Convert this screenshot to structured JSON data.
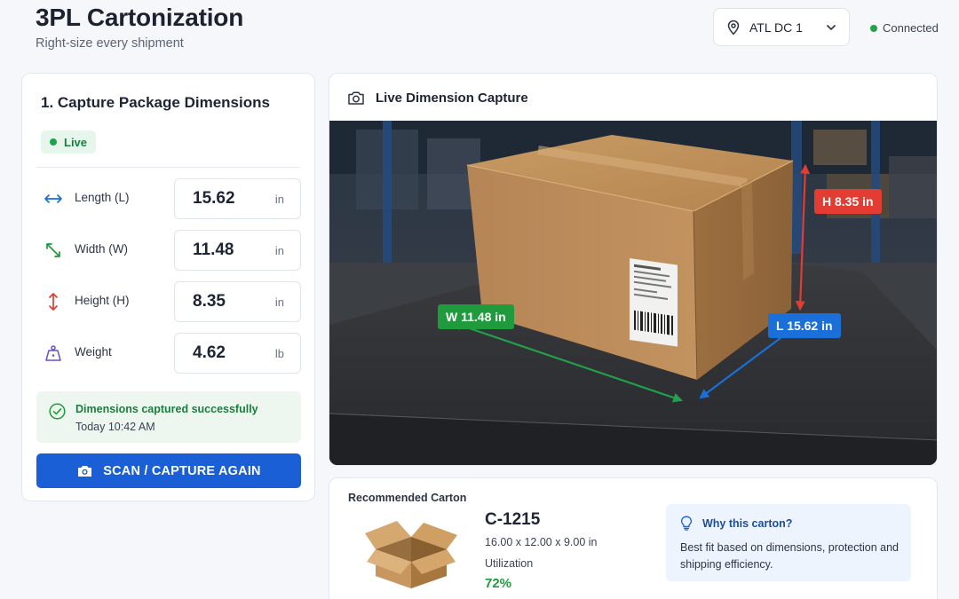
{
  "header": {
    "title": "3PL Cartonization",
    "subtitle": "Right-size every shipment",
    "site": "ATL DC 1",
    "status": "Connected"
  },
  "capture": {
    "title": "1. Capture Package Dimensions",
    "live_label": "Live",
    "fields": [
      {
        "label": "Length (L)",
        "value": "15.62",
        "unit": "in",
        "icon": "horizontal-arrows-icon"
      },
      {
        "label": "Width (W)",
        "value": "11.48",
        "unit": "in",
        "icon": "diagonal-arrows-icon"
      },
      {
        "label": "Height (H)",
        "value": "8.35",
        "unit": "in",
        "icon": "vertical-arrows-icon"
      },
      {
        "label": "Weight",
        "value": "4.62",
        "unit": "lb",
        "icon": "weight-icon"
      }
    ],
    "success_title": "Dimensions captured successfully",
    "success_time": "Today 10:42 AM",
    "scan_button": "SCAN / CAPTURE AGAIN"
  },
  "camera": {
    "title": "Live Dimension Capture",
    "height_tag": "H 8.35 in",
    "width_tag": "W 11.48 in",
    "length_tag": "L 15.62 in"
  },
  "recommendation": {
    "label": "Recommended Carton",
    "carton_id": "C-1215",
    "carton_size": "16.00 x 12.00 x 9.00 in",
    "utilization_label": "Utilization",
    "utilization_value": "72%",
    "why_title": "Why this carton?",
    "why_text": "Best fit based on dimensions, protection and shipping efficiency."
  },
  "colors": {
    "primary": "#1a5fd6",
    "success": "#1f9a3c",
    "height_tag": "#e23c33",
    "width_tag": "#1f9a3c",
    "length_tag": "#1a6fd8"
  }
}
